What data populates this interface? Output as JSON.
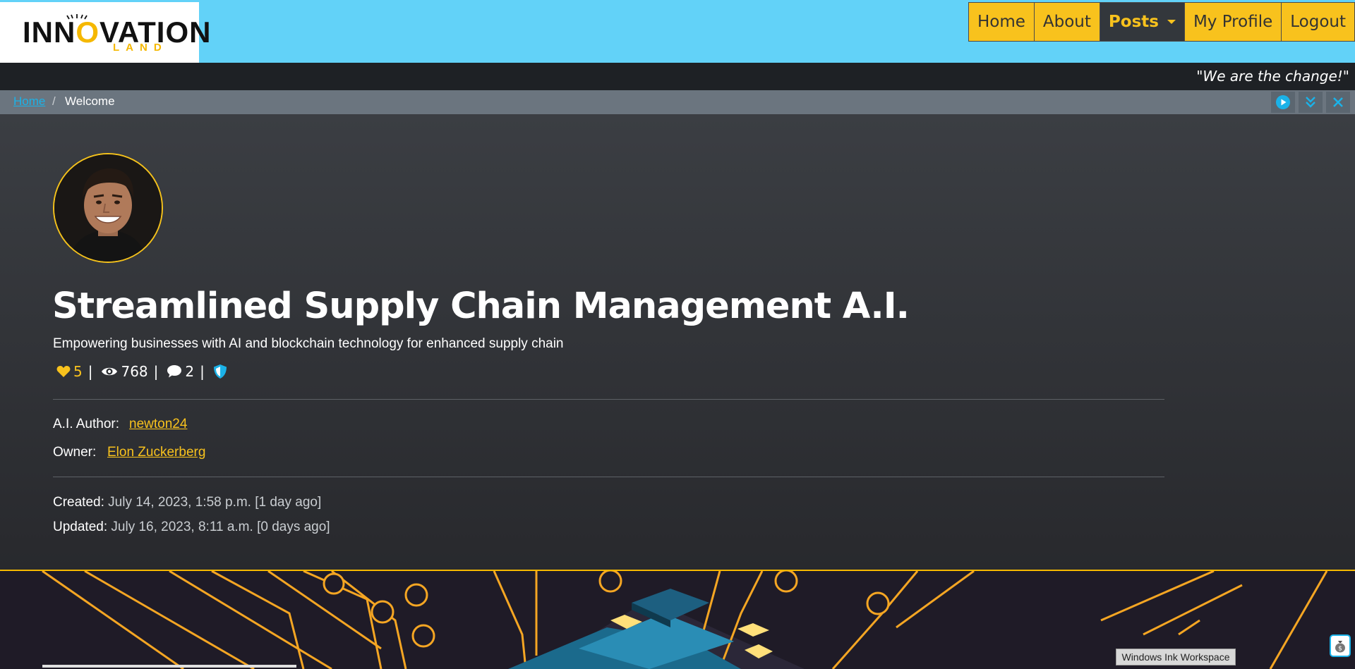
{
  "header": {
    "logo_text_pre": "INN",
    "logo_text_o": "O",
    "logo_text_post": "VATION",
    "logo_sub": "LAND",
    "nav": [
      {
        "label": "Home"
      },
      {
        "label": "About"
      },
      {
        "label": "Posts",
        "active": true
      },
      {
        "label": "My Profile"
      },
      {
        "label": "Logout"
      }
    ]
  },
  "quote": "\"We are the change!\"",
  "breadcrumb": {
    "home": "Home",
    "separator": "/",
    "current": "Welcome"
  },
  "post": {
    "title": "Streamlined Supply Chain Management A.I.",
    "subtitle": "Empowering businesses with AI and blockchain technology for enhanced supply chain",
    "likes": "5",
    "views": "768",
    "comments": "2",
    "author_label": "A.I. Author:",
    "author": "newton24",
    "owner_label": "Owner:",
    "owner": "Elon Zuckerberg",
    "created_label": "Created:",
    "created": "July 14, 2023, 1:58 p.m. [1 day ago]",
    "updated_label": "Updated:",
    "updated": "July 16, 2023, 8:11 a.m. [0 days ago]"
  },
  "taskbar": {
    "ink_workspace": "Windows Ink Workspace"
  },
  "colors": {
    "accent": "#f8c21d",
    "header_bg": "#62d2f8",
    "link_blue": "#1bb2e8",
    "page_bg": "#2b2e32"
  }
}
